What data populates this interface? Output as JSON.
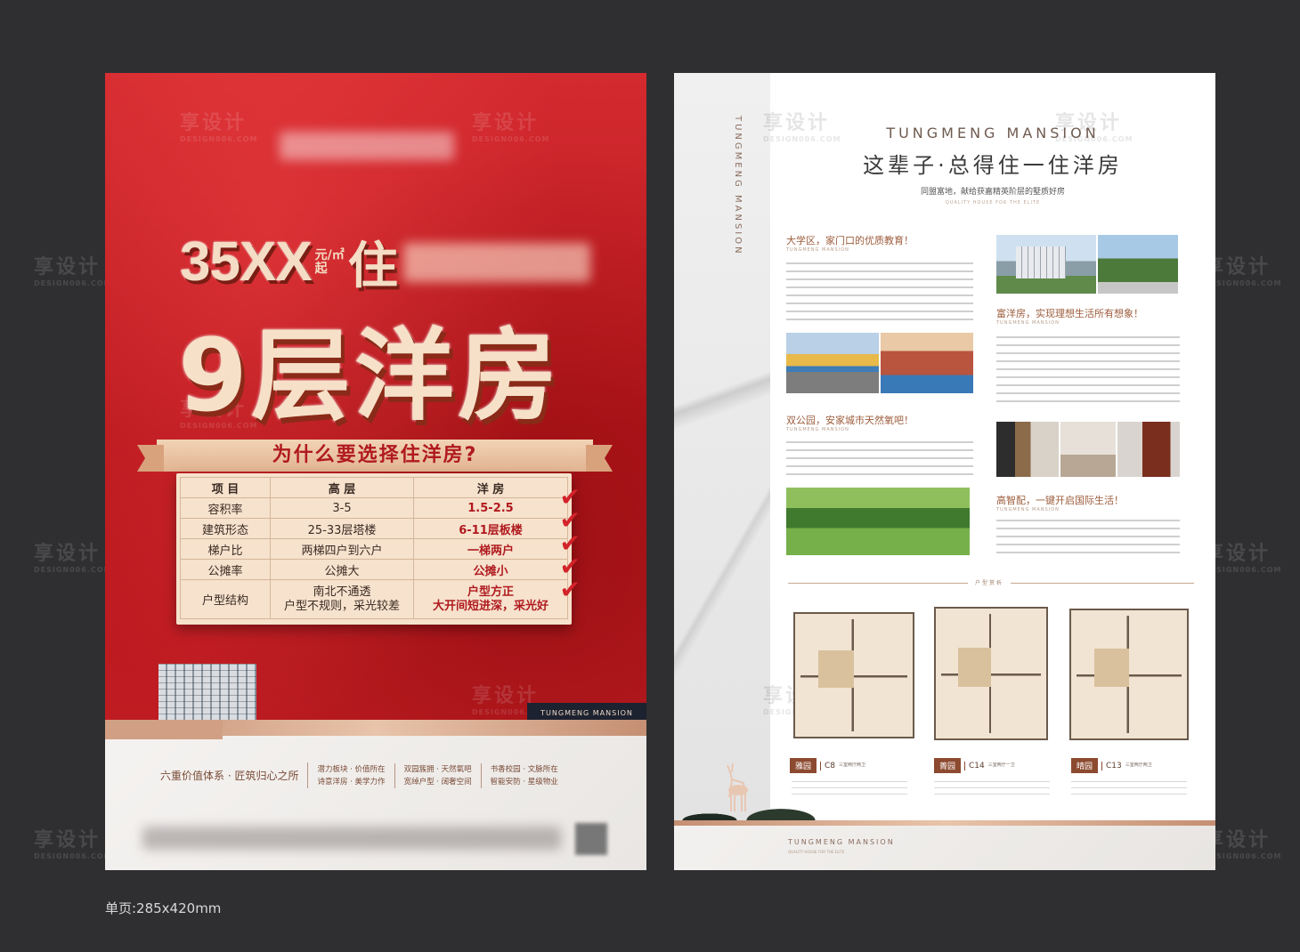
{
  "watermark": {
    "cn": "享设计",
    "en": "DESIGN006.COM"
  },
  "left": {
    "price": "35XX",
    "unit_top": "元/㎡",
    "unit_bottom": "起",
    "zhu": "住",
    "big_title": "9层洋房",
    "why_title": "为什么要选择住洋房?",
    "table": {
      "headers": [
        "项 目",
        "高 层",
        "洋 房"
      ],
      "rows": [
        [
          "容积率",
          "3-5",
          "1.5-2.5"
        ],
        [
          "建筑形态",
          "25-33层塔楼",
          "6-11层板楼"
        ],
        [
          "梯户比",
          "两梯四户到六户",
          "一梯两户"
        ],
        [
          "公摊率",
          "公摊大",
          "公摊小"
        ],
        [
          "户型结构",
          "南北不通透\n户型不规则，采光较差",
          "户型方正\n大开间短进深，采光好"
        ]
      ],
      "check": "✔"
    },
    "badge": "TUNGMENG MANSION",
    "six_title": "六重价值体系 · 匠筑归心之所",
    "six_cols": [
      [
        "潜力板块 · 价值所在",
        "诗意洋房 · 美学力作"
      ],
      [
        "双园簇拥 · 天然氧吧",
        "宽绰户型 · 阔奢空间"
      ],
      [
        "书香校园 · 文脉所在",
        "智能安防 · 星级物业"
      ]
    ]
  },
  "right": {
    "vertical_title": "TUNGMENG MANSION",
    "mansion": "TUNGMENG MANSION",
    "headline": "这辈子·总得住一住洋房",
    "subhead": "同盟富地，献给获嘉精英阶层的墅质好房",
    "subhead_en": "QUALITY HOUSE FOR THE ELITE",
    "sections": [
      {
        "title": "大学区，家门口的优质教育！",
        "en": "TUNGMENG MANSION"
      },
      {
        "title": "富洋房，实现理想生活所有想象！",
        "en": "TUNGMENG MANSION"
      },
      {
        "title": "双公园，安家城市天然氧吧！",
        "en": "TUNGMENG MANSION"
      },
      {
        "title": "高智配，一键开启国际生活！",
        "en": "TUNGMENG MANSION"
      }
    ],
    "floor_plan_label": "户型赏析",
    "plans": [
      {
        "name": "雅园",
        "code": "C8",
        "desc": "三室两厅两卫"
      },
      {
        "name": "菁园",
        "code": "C14",
        "desc": "三室两厅一卫"
      },
      {
        "name": "晴园",
        "code": "C13",
        "desc": "三室两厅两卫"
      }
    ],
    "footer_mansion": "TUNGMENG MANSION",
    "footer_en": "QUALITY HOUSE FOR THE ELITE"
  },
  "size_label": "单页:285x420mm"
}
